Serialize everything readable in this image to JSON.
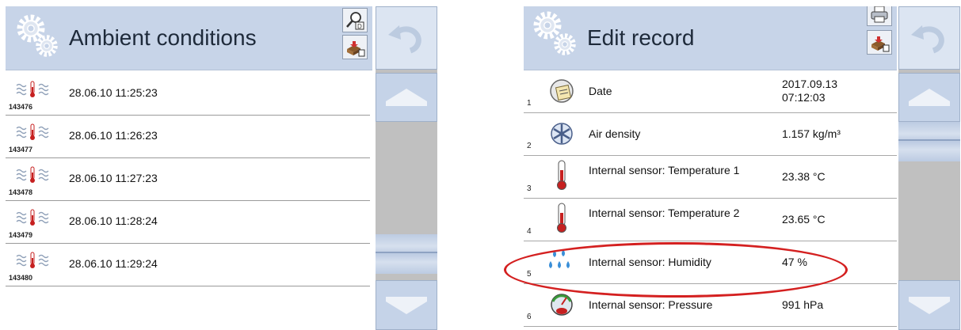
{
  "left": {
    "title": "Ambient conditions",
    "records": [
      {
        "id": "143476",
        "timestamp": "28.06.10 11:25:23"
      },
      {
        "id": "143477",
        "timestamp": "28.06.10 11:26:23"
      },
      {
        "id": "143478",
        "timestamp": "28.06.10 11:27:23"
      },
      {
        "id": "143479",
        "timestamp": "28.06.10 11:28:24"
      },
      {
        "id": "143480",
        "timestamp": "28.06.10 11:29:24"
      }
    ]
  },
  "right": {
    "title": "Edit record",
    "fields": [
      {
        "num": "1",
        "label": "Date",
        "value": "2017.09.13\n07:12:03",
        "icon": "calendar-icon"
      },
      {
        "num": "2",
        "label": "Air density",
        "value": "1.157 kg/m³",
        "icon": "air-density-icon"
      },
      {
        "num": "3",
        "label": "Internal sensor: Temperature 1",
        "value": "23.38 °C",
        "icon": "thermometer-icon"
      },
      {
        "num": "4",
        "label": "Internal sensor: Temperature 2",
        "value": "23.65 °C",
        "icon": "thermometer-icon"
      },
      {
        "num": "5",
        "label": "Internal sensor: Humidity",
        "value": "47 %",
        "icon": "humidity-drops-icon"
      },
      {
        "num": "6",
        "label": "Internal sensor: Pressure",
        "value": "991 hPa",
        "icon": "pressure-gauge-icon"
      }
    ]
  },
  "colors": {
    "header_bg": "#c7d4e8",
    "side_button_bg": "#c5d3e8",
    "scrollbar_track": "#c0c0c0",
    "highlight": "#d42020",
    "thermometer_red": "#c62020"
  },
  "icons": {
    "settings": "gears-icon",
    "details": "search-details-icon",
    "export": "export-icon",
    "print": "printer-icon",
    "undo": "undo-arrow-icon",
    "scroll_up": "arrow-up-icon",
    "scroll_down": "arrow-down-icon"
  }
}
